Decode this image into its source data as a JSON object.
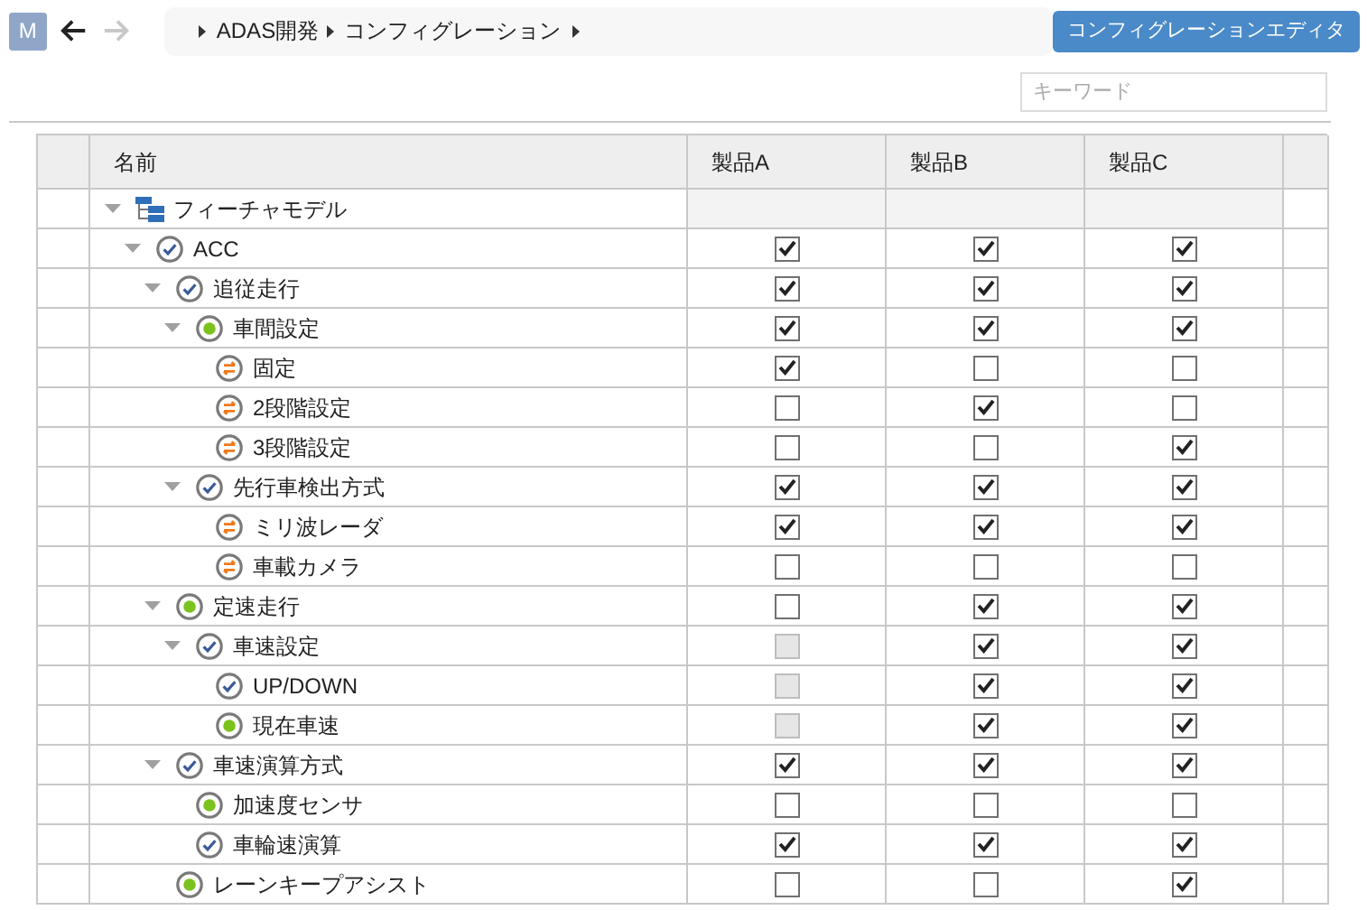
{
  "toolbar": {
    "avatar": "M",
    "breadcrumb": [
      "ADAS開発",
      "コンフィグレーション"
    ],
    "editor_button": "コンフィグレーションエディタ"
  },
  "search": {
    "placeholder": "キーワード"
  },
  "table": {
    "columns": [
      "名前",
      "製品A",
      "製品B",
      "製品C"
    ],
    "tree": [
      {
        "name": "フィーチャモデル",
        "kind": "tree",
        "expanded": true,
        "children": [
          {
            "name": "ACC",
            "kind": "check",
            "expanded": true,
            "cells": [
              {
                "checked": true,
                "disabled": false
              },
              {
                "checked": true,
                "disabled": false
              },
              {
                "checked": true,
                "disabled": false
              }
            ],
            "children": [
              {
                "name": "追従走行",
                "kind": "check",
                "expanded": true,
                "cells": [
                  {
                    "checked": true,
                    "disabled": false
                  },
                  {
                    "checked": true,
                    "disabled": false
                  },
                  {
                    "checked": true,
                    "disabled": false
                  }
                ],
                "children": [
                  {
                    "name": "車間設定",
                    "kind": "dot",
                    "expanded": true,
                    "cells": [
                      {
                        "checked": true,
                        "disabled": false
                      },
                      {
                        "checked": true,
                        "disabled": false
                      },
                      {
                        "checked": true,
                        "disabled": false
                      }
                    ],
                    "children": [
                      {
                        "name": "固定",
                        "kind": "swap",
                        "cells": [
                          {
                            "checked": true,
                            "disabled": false
                          },
                          {
                            "checked": false,
                            "disabled": false
                          },
                          {
                            "checked": false,
                            "disabled": false
                          }
                        ]
                      },
                      {
                        "name": "2段階設定",
                        "kind": "swap",
                        "cells": [
                          {
                            "checked": false,
                            "disabled": false
                          },
                          {
                            "checked": true,
                            "disabled": false
                          },
                          {
                            "checked": false,
                            "disabled": false
                          }
                        ]
                      },
                      {
                        "name": "3段階設定",
                        "kind": "swap",
                        "cells": [
                          {
                            "checked": false,
                            "disabled": false
                          },
                          {
                            "checked": false,
                            "disabled": false
                          },
                          {
                            "checked": true,
                            "disabled": false
                          }
                        ]
                      }
                    ]
                  },
                  {
                    "name": "先行車検出方式",
                    "kind": "check",
                    "expanded": true,
                    "cells": [
                      {
                        "checked": true,
                        "disabled": false
                      },
                      {
                        "checked": true,
                        "disabled": false
                      },
                      {
                        "checked": true,
                        "disabled": false
                      }
                    ],
                    "children": [
                      {
                        "name": "ミリ波レーダ",
                        "kind": "swap",
                        "cells": [
                          {
                            "checked": true,
                            "disabled": false
                          },
                          {
                            "checked": true,
                            "disabled": false
                          },
                          {
                            "checked": true,
                            "disabled": false
                          }
                        ]
                      },
                      {
                        "name": "車載カメラ",
                        "kind": "swap",
                        "cells": [
                          {
                            "checked": false,
                            "disabled": false
                          },
                          {
                            "checked": false,
                            "disabled": false
                          },
                          {
                            "checked": false,
                            "disabled": false
                          }
                        ]
                      }
                    ]
                  }
                ]
              },
              {
                "name": "定速走行",
                "kind": "dot",
                "expanded": true,
                "cells": [
                  {
                    "checked": false,
                    "disabled": false
                  },
                  {
                    "checked": true,
                    "disabled": false
                  },
                  {
                    "checked": true,
                    "disabled": false
                  }
                ],
                "children": [
                  {
                    "name": "車速設定",
                    "kind": "check",
                    "expanded": true,
                    "cells": [
                      {
                        "checked": false,
                        "disabled": true
                      },
                      {
                        "checked": true,
                        "disabled": false
                      },
                      {
                        "checked": true,
                        "disabled": false
                      }
                    ],
                    "children": [
                      {
                        "name": "UP/DOWN",
                        "kind": "check",
                        "cells": [
                          {
                            "checked": false,
                            "disabled": true
                          },
                          {
                            "checked": true,
                            "disabled": false
                          },
                          {
                            "checked": true,
                            "disabled": false
                          }
                        ]
                      },
                      {
                        "name": "現在車速",
                        "kind": "dot",
                        "cells": [
                          {
                            "checked": false,
                            "disabled": true
                          },
                          {
                            "checked": true,
                            "disabled": false
                          },
                          {
                            "checked": true,
                            "disabled": false
                          }
                        ]
                      }
                    ]
                  }
                ]
              },
              {
                "name": "車速演算方式",
                "kind": "check",
                "expanded": true,
                "cells": [
                  {
                    "checked": true,
                    "disabled": false
                  },
                  {
                    "checked": true,
                    "disabled": false
                  },
                  {
                    "checked": true,
                    "disabled": false
                  }
                ],
                "children": [
                  {
                    "name": "加速度センサ",
                    "kind": "dot",
                    "cells": [
                      {
                        "checked": false,
                        "disabled": false
                      },
                      {
                        "checked": false,
                        "disabled": false
                      },
                      {
                        "checked": false,
                        "disabled": false
                      }
                    ]
                  },
                  {
                    "name": "車輪速演算",
                    "kind": "check",
                    "cells": [
                      {
                        "checked": true,
                        "disabled": false
                      },
                      {
                        "checked": true,
                        "disabled": false
                      },
                      {
                        "checked": true,
                        "disabled": false
                      }
                    ]
                  }
                ]
              },
              {
                "name": "レーンキープアシスト",
                "kind": "dot",
                "cells": [
                  {
                    "checked": false,
                    "disabled": false
                  },
                  {
                    "checked": false,
                    "disabled": false
                  },
                  {
                    "checked": true,
                    "disabled": false
                  }
                ]
              }
            ]
          }
        ]
      }
    ]
  }
}
